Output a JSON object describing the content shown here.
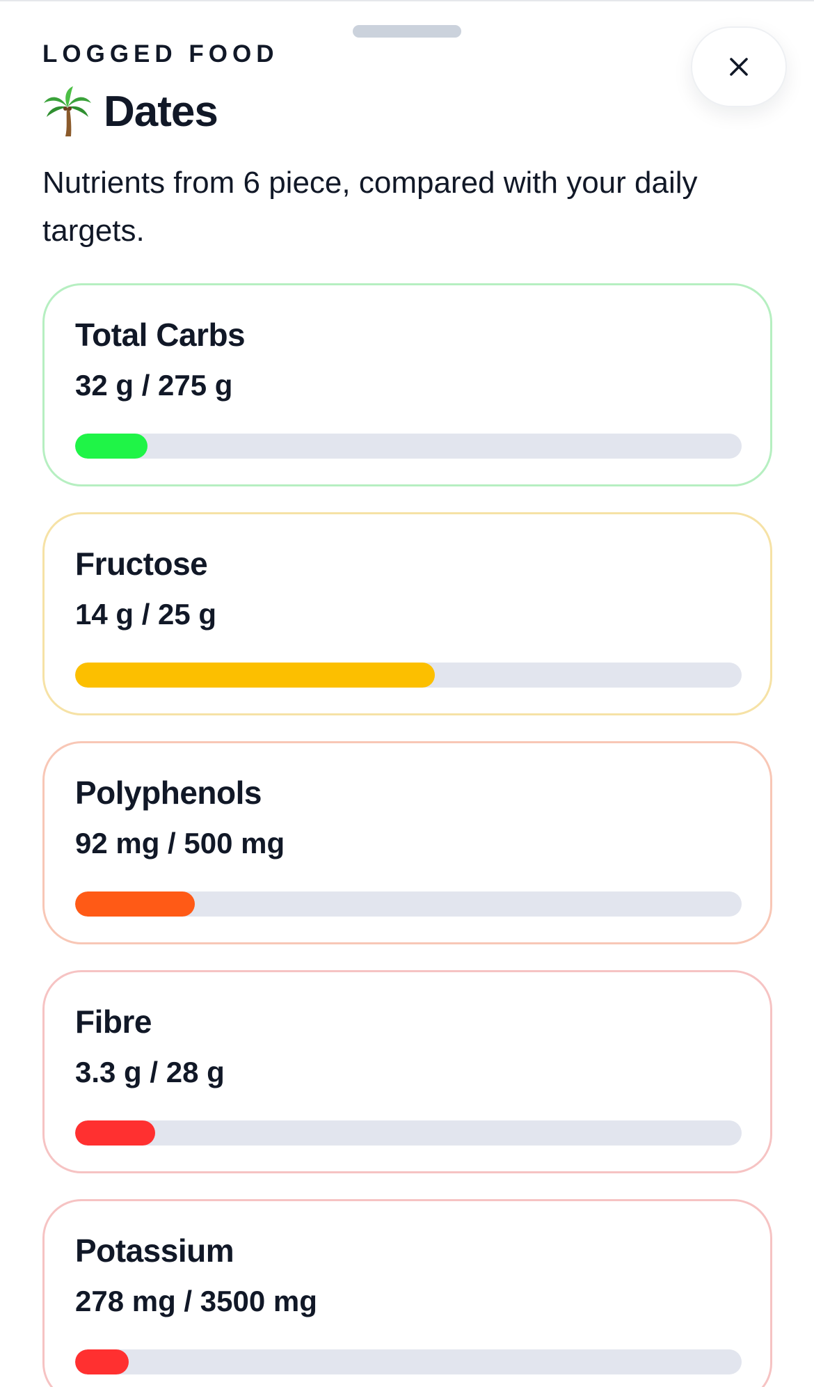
{
  "header": {
    "eyebrow": "LOGGED FOOD",
    "food_icon": "palm-tree-icon",
    "title": "Dates",
    "subtitle": "Nutrients from 6 piece, compared with your daily targets.",
    "close_icon": "close-icon"
  },
  "nutrients": [
    {
      "name": "Total Carbs",
      "value_text": "32 g / 275 g",
      "progress": 0.109,
      "bar_color": "#1ff447",
      "border_color": "#b6efc1"
    },
    {
      "name": "Fructose",
      "value_text": "14 g / 25 g",
      "progress": 0.54,
      "bar_color": "#fcbf00",
      "border_color": "#f6e2a6"
    },
    {
      "name": "Polyphenols",
      "value_text": "92 mg / 500 mg",
      "progress": 0.18,
      "bar_color": "#ff5a16",
      "border_color": "#f8c7b6"
    },
    {
      "name": "Fibre",
      "value_text": "3.3 g / 28 g",
      "progress": 0.12,
      "bar_color": "#ff3030",
      "border_color": "#f6c3c3"
    },
    {
      "name": "Potassium",
      "value_text": "278 mg / 3500 mg",
      "progress": 0.08,
      "bar_color": "#ff3030",
      "border_color": "#f6c3c3"
    }
  ]
}
